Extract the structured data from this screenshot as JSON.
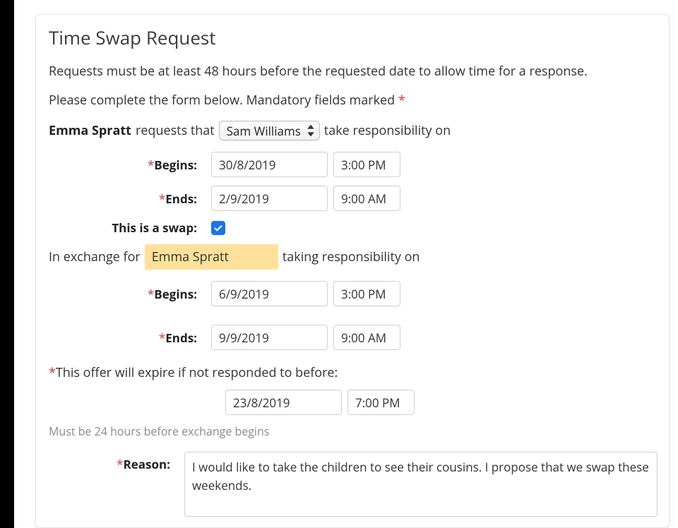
{
  "title": "Time Swap Request",
  "helper1": "Requests must be at least 48 hours before the requested date to allow time for a response.",
  "helper2_pre": "Please complete the form below. Mandatory fields marked ",
  "request_sentence": {
    "requester_name": "Emma Spratt",
    "part1": " requests that",
    "responder_select": "Sam Williams",
    "part2": "take responsibility on"
  },
  "labels": {
    "begins": "Begins:",
    "ends": "Ends:",
    "is_swap": "This is a swap:",
    "reason": "Reason:"
  },
  "first_period": {
    "begins_date": "30/8/2019",
    "begins_time": "3:00 PM",
    "ends_date": "2/9/2019",
    "ends_time": "9:00 AM"
  },
  "is_swap_checked": true,
  "exchange_sentence": {
    "pre": "In exchange for",
    "name": "Emma Spratt",
    "post": "taking responsibility on"
  },
  "second_period": {
    "begins_date": "6/9/2019",
    "begins_time": "3:00 PM",
    "ends_date": "9/9/2019",
    "ends_time": "9:00 AM"
  },
  "expiry": {
    "label": "This offer will expire if not responded to before:",
    "date": "23/8/2019",
    "time": "7:00 PM",
    "hint": "Must be 24 hours before exchange begins"
  },
  "reason_text": "I would like to take the children to see their cousins. I propose that we swap these weekends."
}
